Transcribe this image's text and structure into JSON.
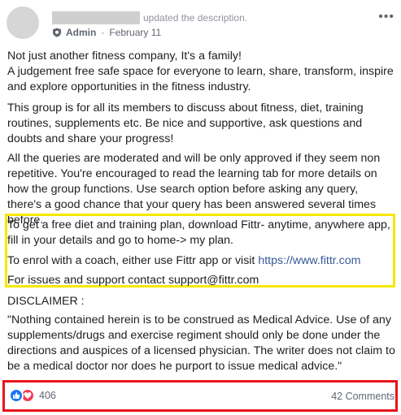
{
  "post": {
    "action": "updated the description.",
    "role": "Admin",
    "separator": "·",
    "date": "February 11",
    "more_label": "•••",
    "p1_line1": "Not just another fitness company, It's a family!",
    "p1_line2": "A judgement free safe space for everyone to learn, share, transform, inspire and explore opportunities in the fitness industry.",
    "p2": "This group is for all its members to discuss about fitness, diet, training routines, supplements etc. Be nice and supportive, ask questions and doubts and share your progress!",
    "p3": "All the queries are moderated and will be only approved if they seem non repetitive. You're encouraged to read the learning tab for more details on how the group functions. Use search option before asking any query, there's a good chance that your query has been answered several times before.",
    "highlight_1": "To get a free diet and training plan, download Fittr- anytime, anywhere app, fill in your details and go to home-> my plan.",
    "highlight_2_text": "To enrol with a coach, either use Fittr app or visit ",
    "highlight_2_link": "https://www.fittr.com",
    "highlight_3": "For issues and support contact support@fittr.com",
    "disclaimer_label": "DISCLAIMER :",
    "disclaimer_text": "\"Nothing contained herein is to be construed as Medical Advice. Use of any supplements/drugs and exercise regiment should only be done under the directions and auspices of a licensed physician. The writer does not claim to be a medical doctor nor does he purport to issue medical advice.\""
  },
  "footer": {
    "reaction_count": "406",
    "comments": "42 Comments",
    "reaction_icons": [
      "like-icon",
      "love-icon"
    ]
  },
  "colors": {
    "highlight_yellow": "#f5e900",
    "highlight_red": "#e8141b",
    "link": "#385898",
    "like_blue": "#1877f2",
    "love_red": "#f33e58"
  }
}
